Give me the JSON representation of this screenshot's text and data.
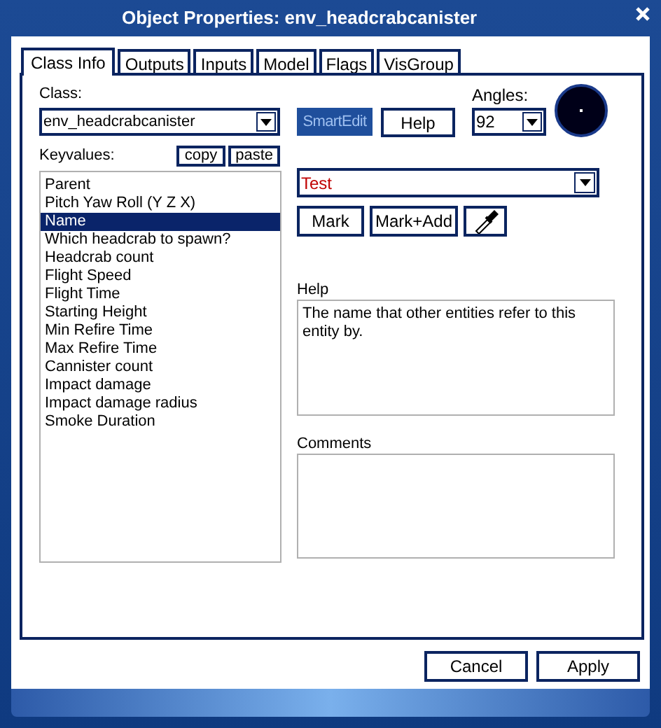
{
  "window": {
    "title": "Object Properties: env_headcrabcanister"
  },
  "tabs": [
    {
      "label": "Class Info",
      "selected": true
    },
    {
      "label": "Outputs",
      "selected": false
    },
    {
      "label": "Inputs",
      "selected": false
    },
    {
      "label": "Model",
      "selected": false
    },
    {
      "label": "Flags",
      "selected": false
    },
    {
      "label": "VisGroup",
      "selected": false
    }
  ],
  "class": {
    "label": "Class:",
    "value": "env_headcrabcanister"
  },
  "smartedit": {
    "label": "SmartEdit",
    "pressed": true
  },
  "help_button": "Help",
  "angles": {
    "label": "Angles:",
    "value": "92"
  },
  "keyvalues": {
    "label": "Keyvalues:",
    "copy": "copy",
    "paste": "paste",
    "items": [
      {
        "label": "Parent",
        "selected": false
      },
      {
        "label": "Pitch Yaw Roll (Y Z X)",
        "selected": false
      },
      {
        "label": "Name",
        "selected": true
      },
      {
        "label": "Which headcrab to spawn?",
        "selected": false
      },
      {
        "label": "Headcrab count",
        "selected": false
      },
      {
        "label": "Flight Speed",
        "selected": false
      },
      {
        "label": "Flight Time",
        "selected": false
      },
      {
        "label": "Starting Height",
        "selected": false
      },
      {
        "label": "Min Refire Time",
        "selected": false
      },
      {
        "label": "Max Refire Time",
        "selected": false
      },
      {
        "label": "Cannister count",
        "selected": false
      },
      {
        "label": "Impact damage",
        "selected": false
      },
      {
        "label": "Impact damage radius",
        "selected": false
      },
      {
        "label": "Smoke Duration",
        "selected": false
      }
    ]
  },
  "value_field": {
    "value": "Test"
  },
  "mark_buttons": [
    "Mark",
    "Mark+Add"
  ],
  "help": {
    "label": "Help",
    "text": "The name that other entities refer to this entity by."
  },
  "comments": {
    "label": "Comments"
  },
  "footer_buttons": [
    "Cancel",
    "Apply"
  ]
}
